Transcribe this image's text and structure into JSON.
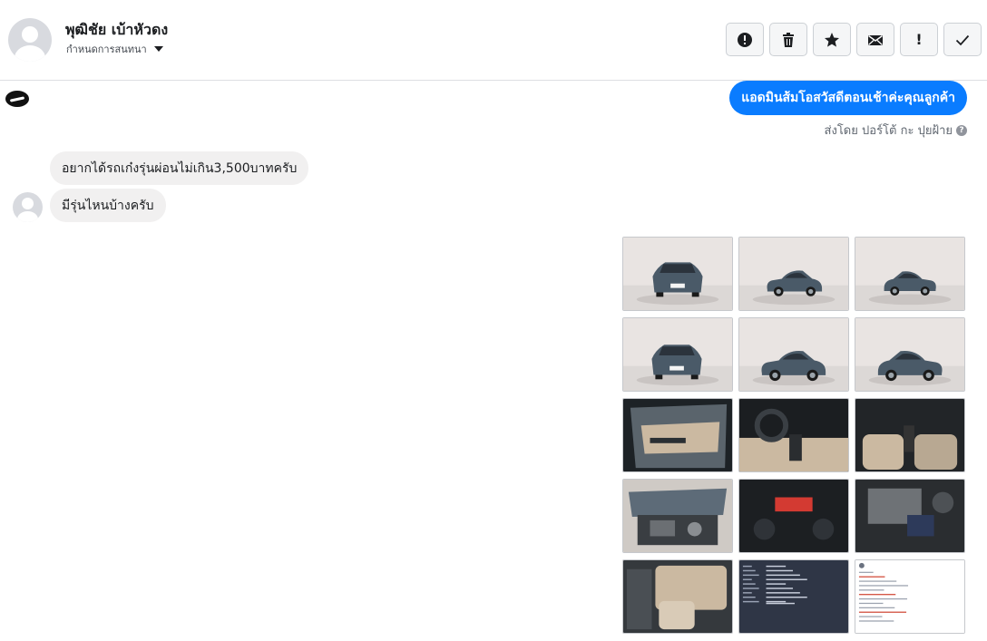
{
  "header": {
    "contact_name": "พุฒิชัย เบ้าหัวดง",
    "assign_label": "กำหนดการสนทนา"
  },
  "toolbar": [
    {
      "icon": "alert-circle-icon",
      "name": "mark-spam-button"
    },
    {
      "icon": "trash-icon",
      "name": "delete-button"
    },
    {
      "icon": "star-icon",
      "name": "star-button"
    },
    {
      "icon": "envelope-icon",
      "name": "mark-unread-button"
    },
    {
      "icon": "exclamation-icon",
      "name": "follow-up-button",
      "glyph": "!"
    },
    {
      "icon": "check-icon",
      "name": "mark-done-button"
    }
  ],
  "messages": {
    "outgoing_text": "แอดมินส้มโอสวัสดีตอนเช้าค่ะคุณลูกค้า",
    "sent_by": "ส่งโดย ปอร์โต้ กะ ปุยฝ้าย",
    "help_glyph": "?",
    "incoming": [
      "อยากได้รถเก๋งรุ่นผ่อนไม่เกิน3,500บาทครับ",
      "มีรุ่นไหนบ้างครับ"
    ]
  },
  "photos": [
    {
      "name": "car-front-photo",
      "kind": "front"
    },
    {
      "name": "car-front-angle-photo",
      "kind": "front-angle"
    },
    {
      "name": "car-rear-angle-photo",
      "kind": "rear-angle"
    },
    {
      "name": "car-rear-photo",
      "kind": "rear"
    },
    {
      "name": "car-side-photo",
      "kind": "side"
    },
    {
      "name": "car-side-rear-photo",
      "kind": "side-rear"
    },
    {
      "name": "car-door-photo",
      "kind": "door"
    },
    {
      "name": "car-dashboard-photo",
      "kind": "dashboard"
    },
    {
      "name": "car-seats-photo",
      "kind": "seats"
    },
    {
      "name": "car-engine-photo",
      "kind": "engine"
    },
    {
      "name": "car-gauge-photo",
      "kind": "gauge"
    },
    {
      "name": "car-engine-detail-photo",
      "kind": "engine-detail"
    },
    {
      "name": "car-rear-seat-photo",
      "kind": "rear-seat"
    },
    {
      "name": "document-dark-screenshot",
      "kind": "doc-dark"
    },
    {
      "name": "document-post-screenshot",
      "kind": "doc-light"
    }
  ],
  "colors": {
    "accent": "#0a7cff",
    "car_body": "#4a5a68",
    "studio_bg": "#e9e4e2",
    "interior_beige": "#cbb9a1",
    "doc_dark": "#2f3646"
  }
}
